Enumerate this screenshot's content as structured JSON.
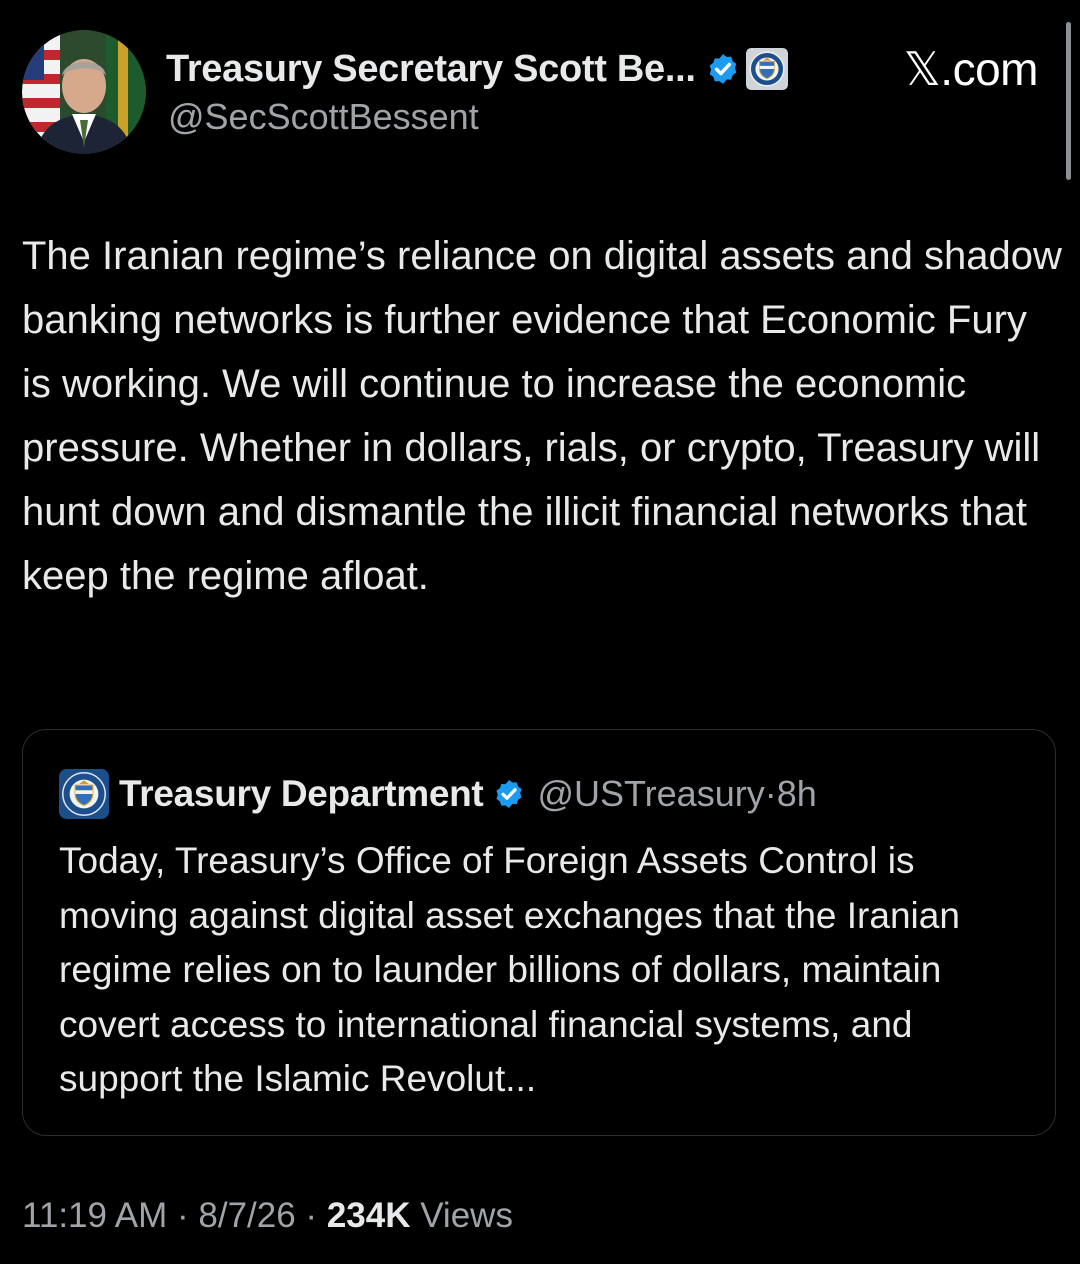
{
  "author": {
    "display_name": "Treasury Secretary Scott Be...",
    "handle": "@SecScottBessent",
    "verified_icon": "verified-badge-icon",
    "affiliation_icon": "treasury-seal-icon"
  },
  "brand": "𝕏.com",
  "tweet": {
    "text": "The Iranian regime’s reliance on digital assets and shadow banking networks is further evidence that Economic Fury is working. We will continue to increase the economic pressure. Whether in dollars, rials, or crypto, Treasury will hunt down and dismantle the illicit financial networks that keep the regime afloat."
  },
  "quoted": {
    "display_name": "Treasury Department",
    "handle": "@USTreasury",
    "separator": "·",
    "age": "8h",
    "text": "Today, Treasury’s Office of Foreign Assets Control is moving against digital asset exchanges that the Iranian regime relies on to launder billions of dollars, maintain covert access to international financial systems, and support the Islamic Revolut..."
  },
  "footer": {
    "time": "11:19 AM",
    "sep1": " · ",
    "date": "8/7/26",
    "sep2": " · ",
    "views_count": "234K",
    "views_label": " Views"
  },
  "colors": {
    "background": "#000000",
    "text": "#e7e9ea",
    "secondary_text": "#a0a4a8",
    "verified": "#1d9bf0",
    "card_border": "#2a2d31"
  }
}
